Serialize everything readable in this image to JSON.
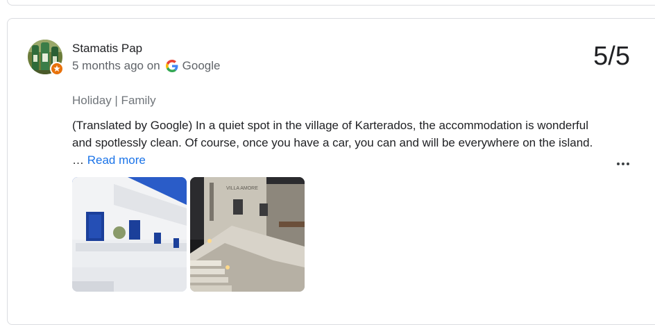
{
  "review": {
    "author": "Stamatis Pap",
    "time": "5 months ago on",
    "source": "Google",
    "rating": "5/5",
    "tags": "Holiday | Family",
    "text": "(Translated by Google) In a quiet spot in the village of Karterados, the accommodation is wonderful and spotlessly clean. Of course, once you have a car, you can and will be everywhere on the island. … ",
    "read_more": "Read more",
    "photo_sign": "VILLA AMORE",
    "icons": {
      "avatar_badge": "local-guide-star-icon",
      "source": "google-g-icon",
      "more": "more-options-icon"
    },
    "colors": {
      "link": "#1a73e8",
      "badge": "#e8710a",
      "text": "#202124",
      "secondary": "#5f6368"
    }
  }
}
